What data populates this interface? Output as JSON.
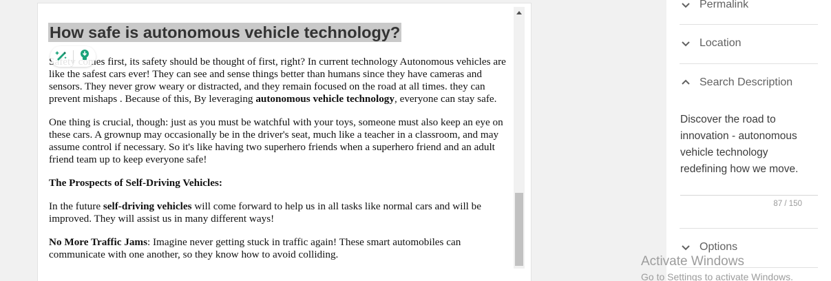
{
  "editor": {
    "title": "How safe is autonomous vehicle technology?",
    "p1_start": "Safety comes first, its safety should be thought of first, right?  In current technology Autonomous vehicles are like the safest cars ever! They can see and sense things better than humans since they have cameras and sensors. They never grow weary or distracted, and they remain focused on the road at all times. they can prevent mishaps . Because of this, By leveraging ",
    "p1_bold": "autonomous vehicle technology",
    "p1_end": ", everyone can stay safe.",
    "p2": "One thing is crucial, though: just as you must be watchful with your toys, someone must also keep an eye on these cars. A grownup may occasionally be in the driver's seat, much like a teacher in a classroom, and may assume control if necessary. So it's like having two superhero friends when a superhero friend and an adult friend team up to keep everyone safe!",
    "h3": "The Prospects of Self-Driving Vehicles:",
    "p3_start": "In the future ",
    "p3_bold": "self-driving vehicles",
    "p3_end": " will come forward to help us in all tasks like normal cars and will be improved. They will assist us in many different ways!",
    "p4_bold": "No More Traffic Jams",
    "p4_end": ": Imagine never getting stuck in traffic again! These smart automobiles can communicate with one another, so they know how to avoid colliding."
  },
  "toolbar": {
    "icons": [
      "magic-pen-icon",
      "lightbulb-icon"
    ],
    "accent": "#1aa37a"
  },
  "sidebar": {
    "sections": [
      {
        "label": "Permalink",
        "icon": "chevron-down-icon"
      },
      {
        "label": "Location",
        "icon": "chevron-down-icon"
      },
      {
        "label": "Search Description",
        "icon": "chevron-up-icon"
      },
      {
        "label": "Options",
        "icon": "chevron-down-icon"
      }
    ],
    "search_description": {
      "text": "Discover the road to innovation - autonomous vehicle technology redefining how we move.",
      "counter": "87 / 150"
    }
  },
  "watermark": {
    "title": "Activate Windows",
    "subtitle": "Go to Settings to activate Windows."
  }
}
